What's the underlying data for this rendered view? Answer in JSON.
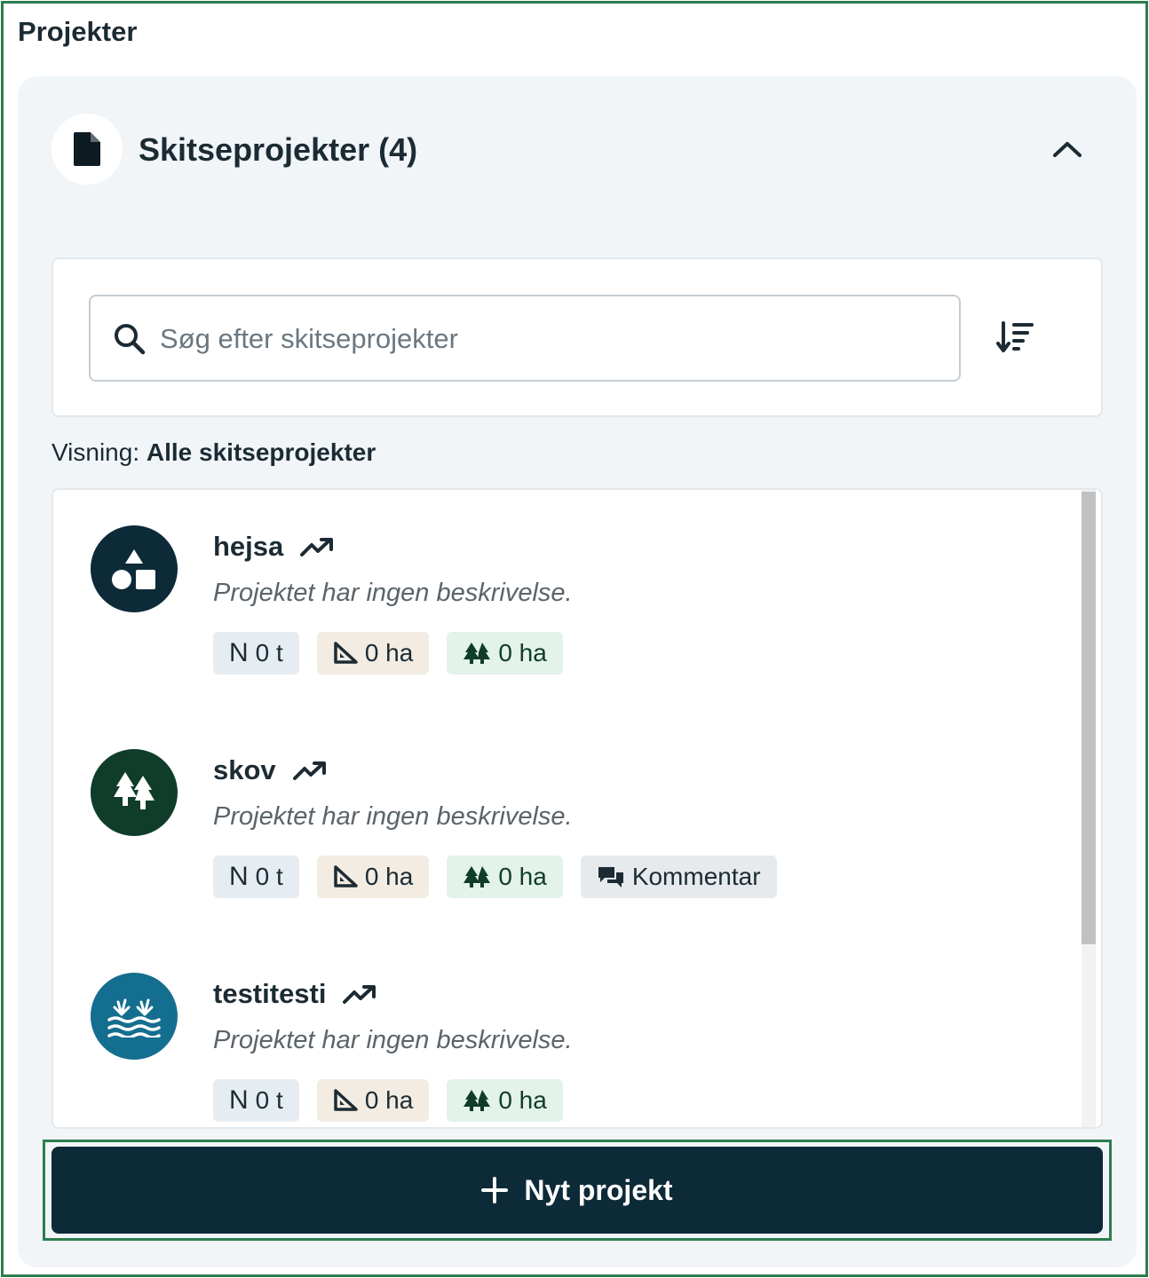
{
  "page": {
    "title": "Projekter"
  },
  "section": {
    "title": "Skitseprojekter (4)",
    "icon": "file-icon",
    "collapse_icon": "chevron-up-icon"
  },
  "search": {
    "placeholder": "Søg efter skitseprojekter",
    "value": "",
    "sort_icon": "sort-descending-icon"
  },
  "view": {
    "prefix": "Visning:",
    "value": "Alle skitseprojekter"
  },
  "projects": [
    {
      "name": "hejsa",
      "description": "Projektet har ingen beskrivelse.",
      "avatar_icon": "shapes-icon",
      "avatar_color": "#0d2a38",
      "n_letter": "N",
      "n_value": "0 t",
      "area_value": "0 ha",
      "forest_value": "0 ha"
    },
    {
      "name": "skov",
      "description": "Projektet har ingen beskrivelse.",
      "avatar_icon": "trees-icon",
      "avatar_color": "#0f3d2a",
      "n_letter": "N",
      "n_value": "0 t",
      "area_value": "0 ha",
      "forest_value": "0 ha",
      "comment": "Kommentar"
    },
    {
      "name": "testitesti",
      "description": "Projektet har ingen beskrivelse.",
      "avatar_icon": "wetland-icon",
      "avatar_color": "#146e8f",
      "n_letter": "N",
      "n_value": "0 t",
      "area_value": "0 ha",
      "forest_value": "0 ha"
    }
  ],
  "actions": {
    "new_project": "Nyt projekt"
  },
  "colors": {
    "accent": "#0d2a38",
    "focus_outline": "#2e7d4f"
  }
}
